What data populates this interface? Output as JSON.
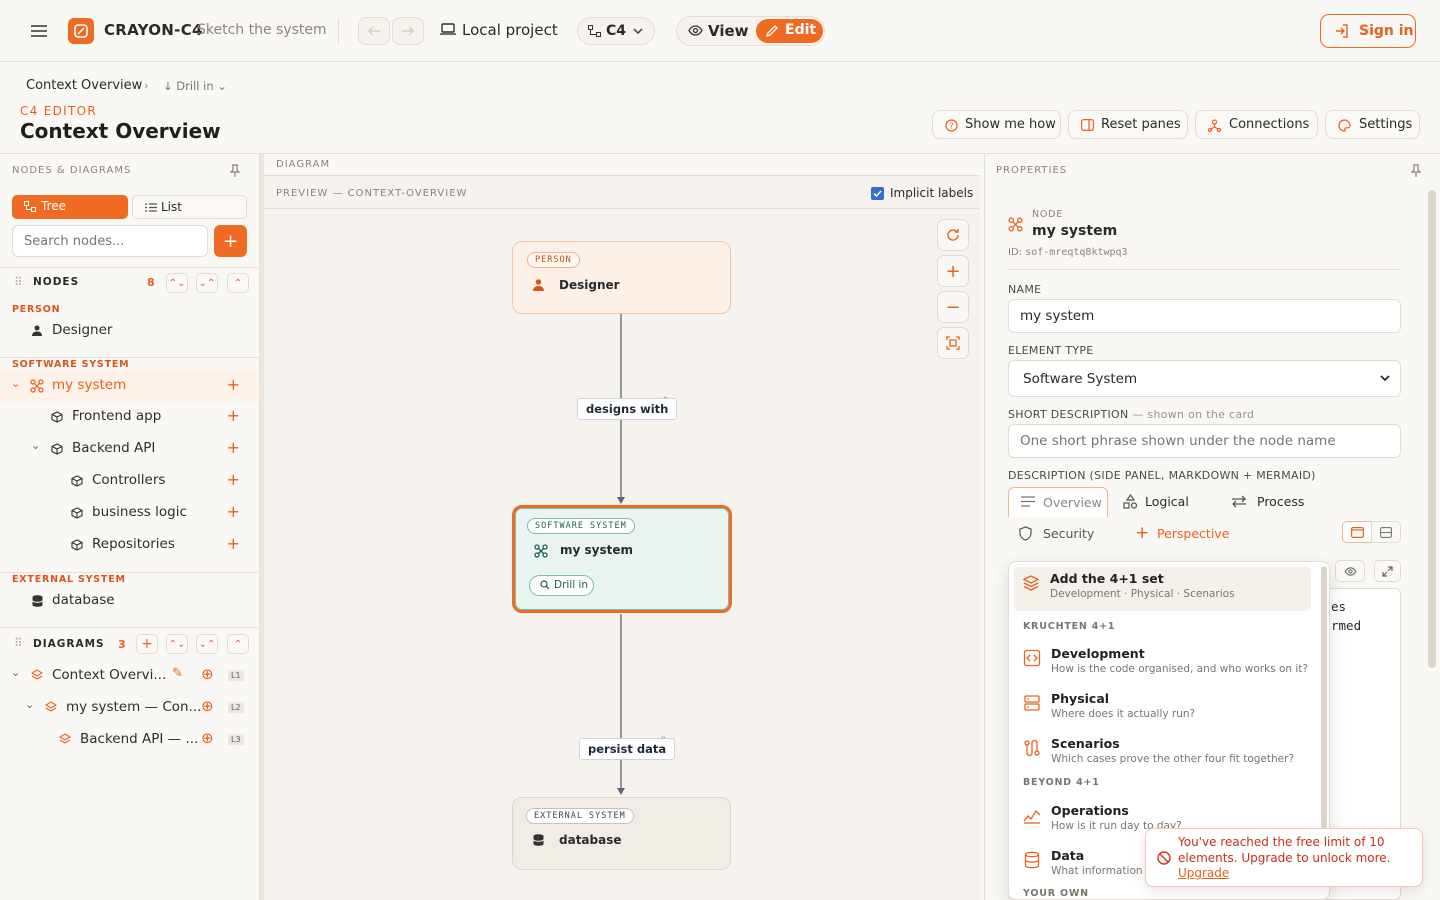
{
  "app": {
    "name": "CRAYON-C4",
    "tagline": "Sketch the system",
    "project": "Local project",
    "notation": "C4",
    "view_label": "View",
    "edit_label": "Edit",
    "sign_in": "Sign in"
  },
  "breadcrumb": {
    "root": "Context Overview",
    "drill": "Drill in"
  },
  "page": {
    "kicker": "C4 EDITOR",
    "title": "Context Overview"
  },
  "actions": {
    "show_me_how": "Show me how",
    "reset_panes": "Reset panes",
    "connections": "Connections",
    "settings": "Settings"
  },
  "left": {
    "header": "NODES & DIAGRAMS",
    "tree_tab": "Tree",
    "list_tab": "List",
    "search_placeholder": "Search nodes...",
    "nodes_label": "NODES",
    "nodes_count": "8",
    "sections": {
      "person": "PERSON",
      "software_system": "SOFTWARE SYSTEM",
      "external_system": "EXTERNAL SYSTEM"
    },
    "nodes": {
      "designer": "Designer",
      "my_system": "my system",
      "frontend": "Frontend app",
      "backend": "Backend API",
      "controllers": "Controllers",
      "business": "business logic",
      "repos": "Repositories",
      "database": "database"
    },
    "diagrams_label": "DIAGRAMS",
    "diagrams_count": "3",
    "diagrams": [
      {
        "label": "Context Overvi...",
        "level": "L1"
      },
      {
        "label": "my system — Con...",
        "level": "L2"
      },
      {
        "label": "Backend API — ...",
        "level": "L3"
      }
    ]
  },
  "canvas": {
    "header": "DIAGRAM",
    "preview": "PREVIEW — CONTEXT-OVERVIEW",
    "implicit_labels": "Implicit labels",
    "person_tag": "PERSON",
    "person_name": "Designer",
    "system_tag": "SOFTWARE SYSTEM",
    "system_name": "my system",
    "drill_in": "Drill in",
    "ext_tag": "EXTERNAL SYSTEM",
    "ext_name": "database",
    "edge1": "designs with",
    "edge2": "persist data"
  },
  "properties": {
    "header": "PROPERTIES",
    "node_kicker": "NODE",
    "node_name": "my system",
    "node_id_label": "ID:",
    "node_id": "sof-mreqtq8ktwpq3",
    "name_label": "NAME",
    "name_value": "my system",
    "type_label": "ELEMENT TYPE",
    "type_value": "Software System",
    "short_label": "SHORT DESCRIPTION",
    "short_hint": "— shown on the card",
    "short_placeholder": "One short phrase shown under the node name",
    "desc_label": "DESCRIPTION (SIDE PANEL, MARKDOWN + MERMAID)",
    "tabs": {
      "overview": "Overview",
      "logical": "Logical",
      "process": "Process",
      "security": "Security",
      "perspective": "Perspective"
    },
    "peek_text": [
      "es",
      "rmed"
    ]
  },
  "dropdown": {
    "add_set_title": "Add the 4+1 set",
    "add_set_sub": "Development · Physical · Scenarios",
    "kruchten": "KRUCHTEN 4+1",
    "development": {
      "title": "Development",
      "sub": "How is the code organised, and who works on it?"
    },
    "physical": {
      "title": "Physical",
      "sub": "Where does it actually run?"
    },
    "scenarios": {
      "title": "Scenarios",
      "sub": "Which cases prove the other four fit together?"
    },
    "beyond": "BEYOND 4+1",
    "operations": {
      "title": "Operations",
      "sub": "How is it run day to day?"
    },
    "data": {
      "title": "Data",
      "sub": "What information"
    },
    "your_own": "YOUR OWN"
  },
  "toast": {
    "message": "You've reached the free limit of 10 elements. Upgrade to unlock more.",
    "link": "Upgrade"
  },
  "colors": {
    "accent": "#ef6a22",
    "system_fill": "#eaf4f1",
    "person_fill": "#fdf0e6",
    "edge": "#5c6675"
  }
}
